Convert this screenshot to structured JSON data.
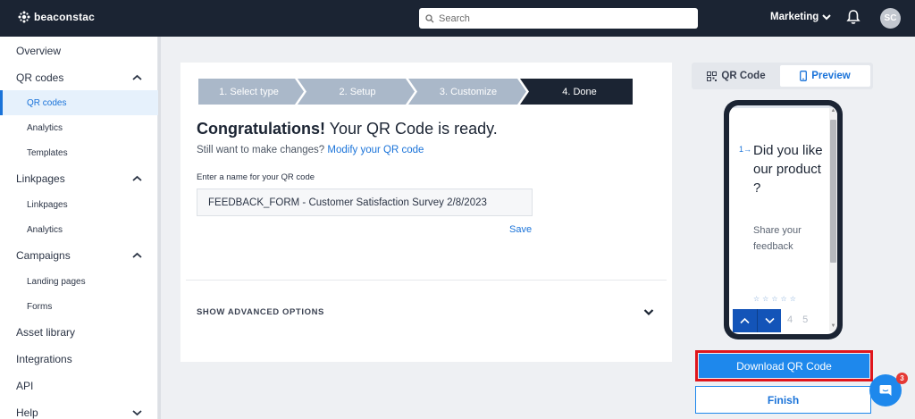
{
  "app": {
    "logo_text": "beaconstac"
  },
  "header": {
    "search_placeholder": "Search",
    "workspace": "Marketing",
    "avatar_initials": "SC"
  },
  "sidebar": {
    "overview": "Overview",
    "qr_codes": "QR codes",
    "qr_codes_children": [
      "QR codes",
      "Analytics",
      "Templates"
    ],
    "linkpages": "Linkpages",
    "linkpages_children": [
      "Linkpages",
      "Analytics"
    ],
    "campaigns": "Campaigns",
    "campaigns_children": [
      "Landing pages",
      "Forms"
    ],
    "asset_library": "Asset library",
    "integrations": "Integrations",
    "api": "API",
    "help": "Help",
    "active_item": "QR codes"
  },
  "stepper": {
    "steps": [
      "1. Select type",
      "2. Setup",
      "3. Customize",
      "4. Done"
    ],
    "current": "4. Done"
  },
  "main": {
    "congrats_bold": "Congratulations!",
    "congrats_rest": " Your QR Code is ready.",
    "still_text": "Still want to make changes?",
    "modify_link": "Modify your QR code",
    "name_label": "Enter a name for your QR code",
    "name_value": "FEEDBACK_FORM - Customer Satisfaction Survey 2/8/2023",
    "save_label": "Save",
    "advanced_label": "SHOW ADVANCED OPTIONS"
  },
  "preview_panel": {
    "tab_qr": "QR Code",
    "tab_preview": "Preview",
    "active_tab": "Preview",
    "question_number": "1→",
    "question_text": "Did you like our product ?",
    "question_sub": "Share your feedback",
    "stars": "☆☆☆☆☆",
    "faded_numbers": "4 5"
  },
  "actions": {
    "download_label": "Download QR Code",
    "finish_label": "Finish"
  },
  "chat": {
    "badge_count": "3"
  },
  "colors": {
    "topbar": "#1b2433",
    "accent": "#1a73d9",
    "step_inactive": "#aab8c9",
    "step_active": "#1b2433",
    "highlight": "#e0161c",
    "download": "#1e88ec"
  },
  "icons": [
    "logo-icon",
    "search-icon",
    "chevron-down-icon",
    "bell-icon",
    "chevron-up-icon",
    "qr-icon",
    "phone-icon",
    "arrow-up-icon",
    "arrow-down-icon",
    "chat-icon"
  ]
}
